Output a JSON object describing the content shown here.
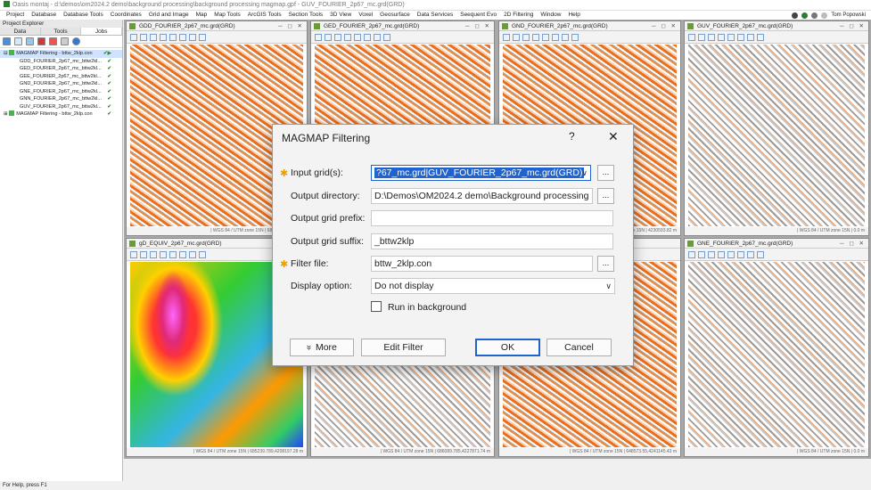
{
  "window": {
    "title": "Oasis montaj - d:\\demos\\om2024.2 demo\\background processing\\background processing magmap.gpf - GUV_FOURIER_2p67_mc.grd(GRD)"
  },
  "menu": [
    "Project",
    "Database",
    "Database Tools",
    "Coordinates",
    "Grid and Image",
    "Map",
    "Map Tools",
    "ArcGIS Tools",
    "Section Tools",
    "3D View",
    "Voxel",
    "Geosurface",
    "Data Services",
    "Seequent Evo",
    "2D Filtering",
    "Window",
    "Help"
  ],
  "user": "Tom Popowski",
  "explorer": {
    "title": "Project Explorer",
    "tabs": [
      "Data",
      "Tools",
      "Jobs"
    ],
    "jobs": [
      {
        "label": "MAGMAP Filtering - bttw_2klp.con",
        "children": [
          "GDD_FOURIER_2p67_mc_bttw2kl...",
          "GED_FOURIER_2p67_mc_bttw2kl...",
          "GEE_FOURIER_2p67_mc_bttw2kl...",
          "GND_FOURIER_2p67_mc_bttw2kl...",
          "GNE_FOURIER_2p67_mc_bttw2kl...",
          "GNN_FOURIER_2p67_mc_bttw2kl...",
          "GUV_FOURIER_2p67_mc_bttw2kl..."
        ]
      },
      {
        "label": "MAGMAP Filtering - bttw_2klp.con",
        "children": []
      }
    ]
  },
  "grids": [
    {
      "title": "GDD_FOURIER_2p67_mc.grd(GRD)",
      "status": "| WGS 84 / UTM zone 15N | 688946.42,4237..."
    },
    {
      "title": "GED_FOURIER_2p67_mc.grd(GRD)",
      "status": ""
    },
    {
      "title": "GND_FOURIER_2p67_mc.grd(GRD)",
      "status": "| WGS 84 / UTM zone 15N | 4230593.82 m"
    },
    {
      "title": "GUV_FOURIER_2p67_mc.grd(GRD)",
      "status": "| WGS 84 / UTM zone 15N | 0.0 m"
    },
    {
      "title": "gD_EQUIV_2p67_mc.grd(GRD)",
      "status": "| WGS 84 / UTM zone 15N | 685239.789,4208197.28 m"
    },
    {
      "title": "",
      "status": "| WGS 84 / UTM zone 15N | 686089.785,4227871.74 m"
    },
    {
      "title": "",
      "status": "| WGS 84 / UTM zone 15N | 648573.55,4241145.43 m"
    },
    {
      "title": "GNE_FOURIER_2p67_mc.grd(GRD)",
      "status": "| WGS 84 / UTM zone 15N | 0.0 m"
    }
  ],
  "dialog": {
    "title": "MAGMAP Filtering",
    "help": "?",
    "close": "✕",
    "input_label": "Input grid(s):",
    "input_value": "?67_mc.grd|GUV_FOURIER_2p67_mc.grd(GRD)",
    "outdir_label": "Output directory:",
    "outdir_value": "D:\\Demos\\OM2024.2 demo\\Background processing",
    "prefix_label": "Output grid prefix:",
    "prefix_value": "",
    "suffix_label": "Output grid suffix:",
    "suffix_value": "_bttw2klp",
    "filter_label": "Filter file:",
    "filter_value": "bttw_2klp.con",
    "display_label": "Display option:",
    "display_value": "Do not display",
    "background_label": "Run in background",
    "more": "More",
    "more_icon": "»",
    "edit_filter": "Edit Filter",
    "ok": "OK",
    "cancel": "Cancel",
    "browse": "...",
    "dropdown": "∨"
  },
  "statusbar": "For Help, press F1"
}
